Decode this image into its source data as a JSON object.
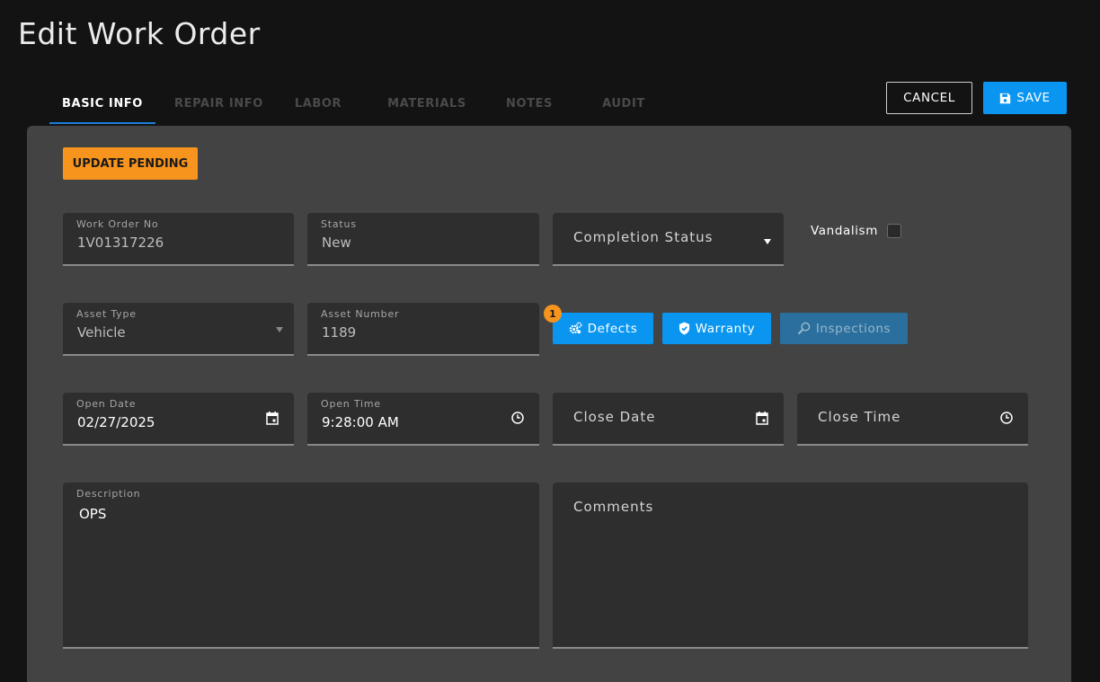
{
  "header": {
    "title": "Edit Work Order"
  },
  "tabs": [
    {
      "label": "BASIC INFO",
      "active": true
    },
    {
      "label": "REPAIR INFO",
      "active": false
    },
    {
      "label": "LABOR",
      "active": false
    },
    {
      "label": "MATERIALS",
      "active": false
    },
    {
      "label": "NOTES",
      "active": false
    },
    {
      "label": "AUDIT",
      "active": false
    }
  ],
  "actions": {
    "cancel_label": "CANCEL",
    "save_label": "SAVE"
  },
  "status_button": {
    "label": "UPDATE PENDING",
    "color": "#f7941d"
  },
  "fields": {
    "work_order_no": {
      "label": "Work Order No",
      "value": "1V01317226"
    },
    "status": {
      "label": "Status",
      "value": "New"
    },
    "completion_status": {
      "placeholder": "Completion Status"
    },
    "vandalism": {
      "label": "Vandalism",
      "checked": false
    },
    "asset_type": {
      "label": "Asset Type",
      "value": "Vehicle"
    },
    "asset_number": {
      "label": "Asset Number",
      "value": "1189"
    },
    "open_date": {
      "label": "Open Date",
      "value": "02/27/2025"
    },
    "open_time": {
      "label": "Open Time",
      "value": "9:28:00 AM"
    },
    "close_date": {
      "placeholder": "Close Date"
    },
    "close_time": {
      "placeholder": "Close Time"
    },
    "description": {
      "label": "Description",
      "value": "OPS"
    },
    "comments": {
      "placeholder": "Comments"
    }
  },
  "chips": {
    "defects": {
      "label": "Defects",
      "badge": "1",
      "icon": "gears-icon"
    },
    "warranty": {
      "label": "Warranty",
      "icon": "shield-check-icon"
    },
    "inspections": {
      "label": "Inspections",
      "icon": "magnifier-icon"
    }
  },
  "colors": {
    "accent": "#0a96f0",
    "warning": "#f7941d",
    "panel": "#434343",
    "background": "#131313"
  }
}
